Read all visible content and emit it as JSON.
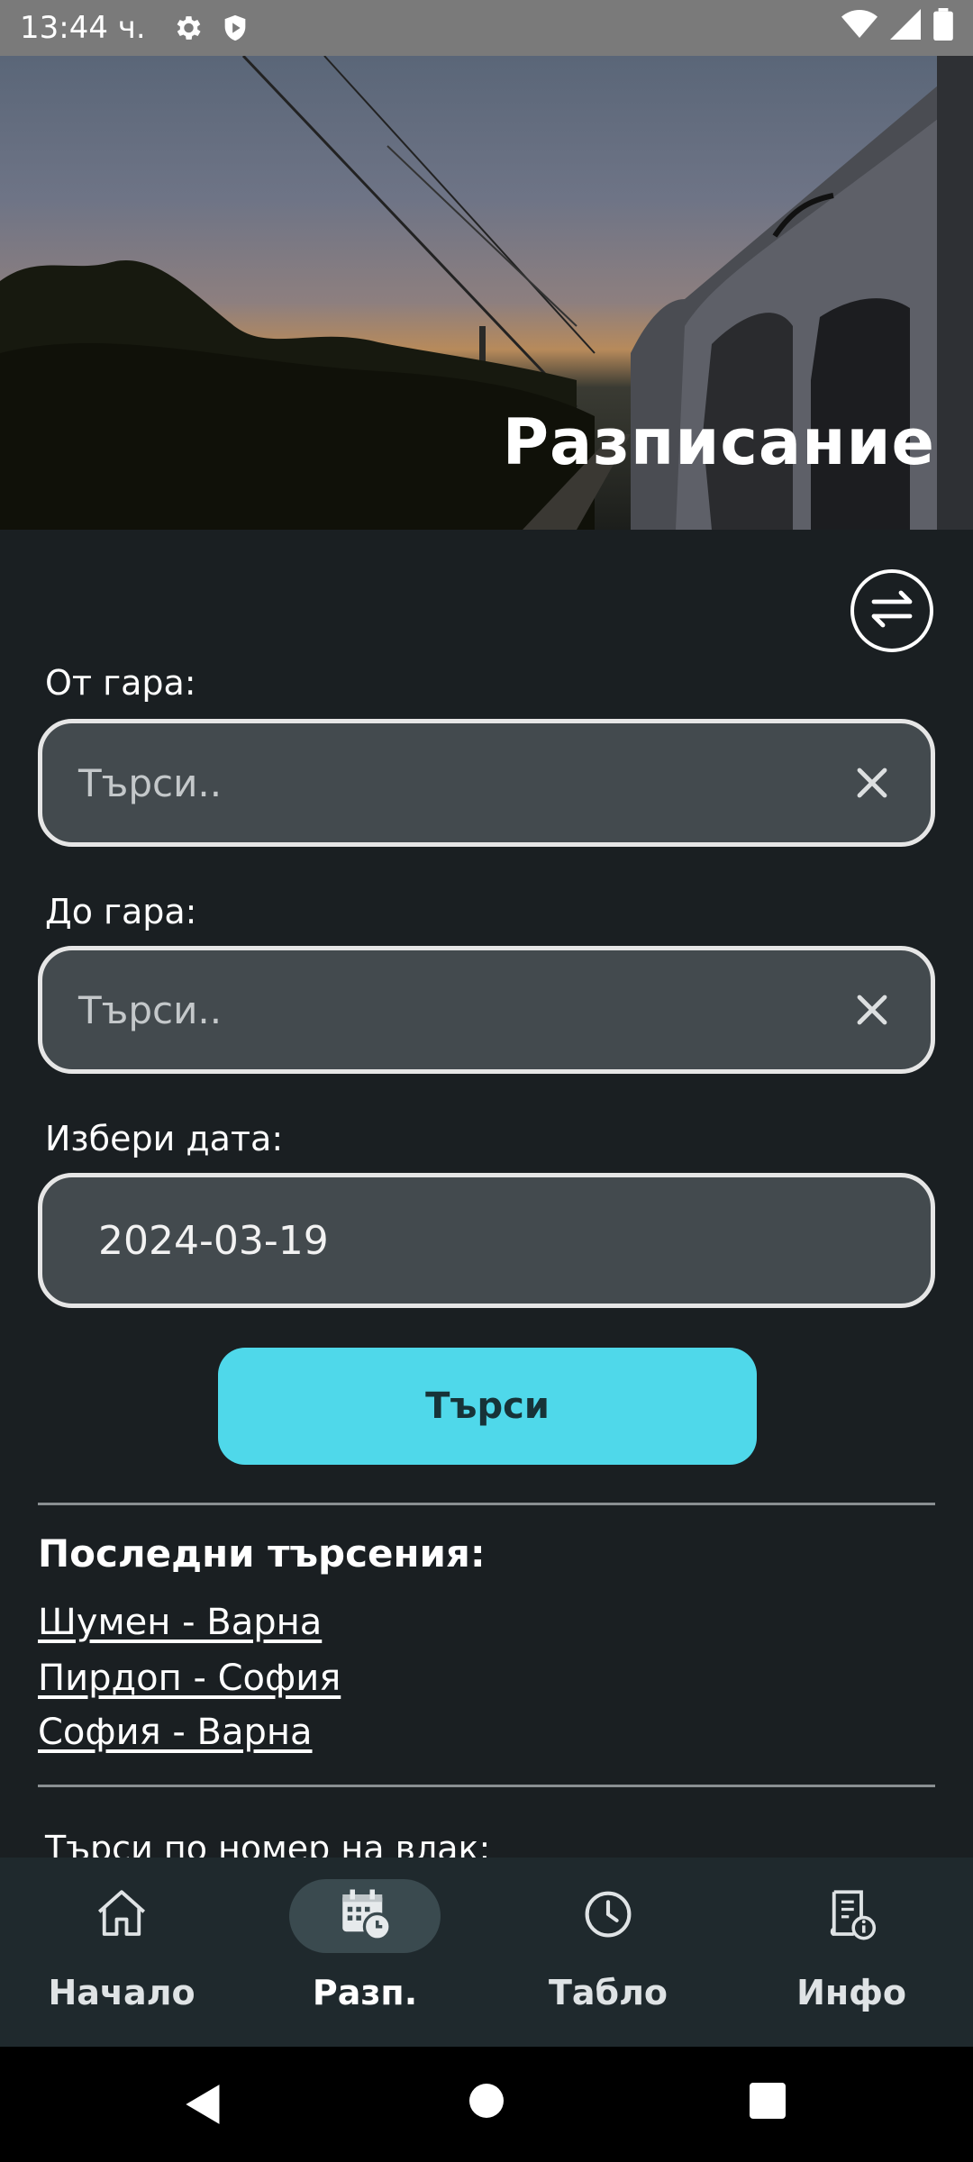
{
  "status_bar": {
    "time": "13:44 ч.",
    "icons": [
      "settings-icon",
      "shield-icon",
      "wifi-icon",
      "signal-icon",
      "battery-icon"
    ]
  },
  "hero": {
    "title": "Разписание"
  },
  "form": {
    "from_label": "От гара:",
    "from_placeholder": "Търси..",
    "to_label": "До гара:",
    "to_placeholder": "Търси..",
    "date_label": "Избери дата:",
    "date_value": "2024-03-19",
    "search_button": "Търси"
  },
  "recent": {
    "title": "Последни търсения:",
    "items": [
      "Шумен - Варна",
      "Пирдоп - София",
      "София - Варна"
    ]
  },
  "train_search_label": "Търси по номер на влак:",
  "bottom_nav": {
    "items": [
      {
        "label": "Начало",
        "icon": "home-icon"
      },
      {
        "label": "Разп.",
        "icon": "calendar-clock-icon"
      },
      {
        "label": "Табло",
        "icon": "clock-icon"
      },
      {
        "label": "Инфо",
        "icon": "info-book-icon"
      }
    ],
    "active": "Разп."
  },
  "colors": {
    "accent": "#4fd8ea",
    "background": "#1a1f22",
    "field": "#434a4e",
    "nav": "#1f292d"
  }
}
